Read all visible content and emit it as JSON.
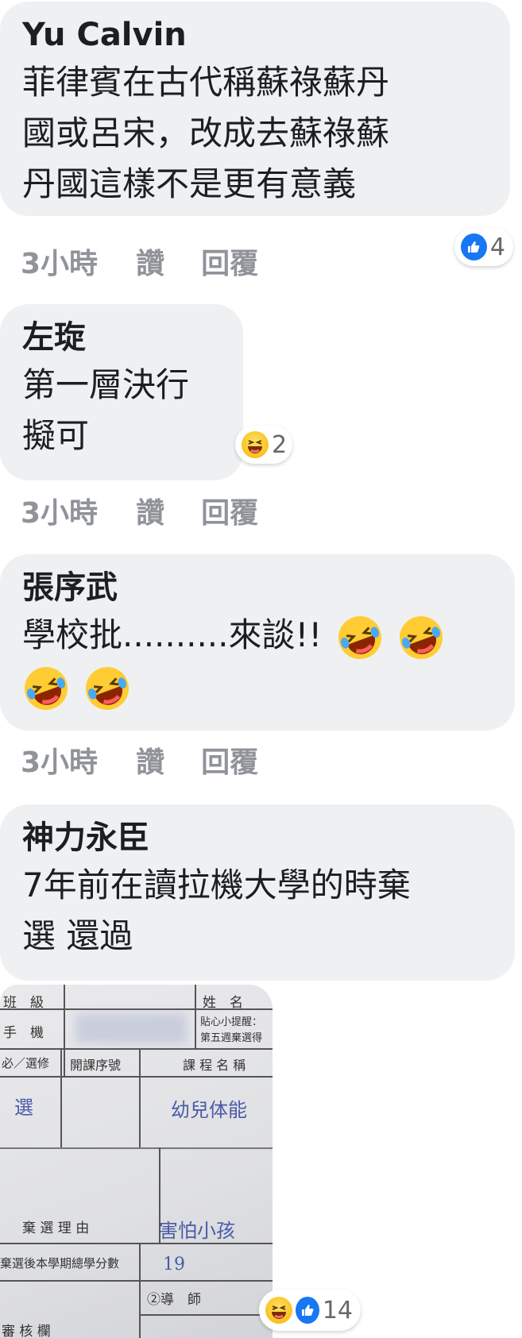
{
  "comments": [
    {
      "author": "Yu Calvin",
      "lines": [
        "菲律賓在古代稱蘇祿蘇丹",
        "國或呂宋，改成去蘇祿蘇",
        "丹國這樣不是更有意義"
      ],
      "time": "3小時",
      "like_label": "讚",
      "reply_label": "回覆",
      "reaction_count": "4",
      "reactions": [
        "like-icon"
      ]
    },
    {
      "author": "左琁",
      "lines": [
        "第一層決行",
        "擬可"
      ],
      "time": "3小時",
      "like_label": "讚",
      "reply_label": "回覆",
      "reaction_count": "2",
      "reactions": [
        "haha-icon"
      ]
    },
    {
      "author": "張序武",
      "lines": [
        "學校批..........來談!!"
      ],
      "time": "3小時",
      "like_label": "讚",
      "reply_label": "回覆",
      "emojis": [
        "rofl-emoji",
        "rofl-emoji",
        "rofl-emoji",
        "rofl-emoji"
      ]
    },
    {
      "author": "神力永臣",
      "lines": [
        "7年前在讀拉機大學的時棄",
        "選 還過"
      ],
      "reaction_count": "14",
      "reactions": [
        "haha-icon",
        "like-icon"
      ],
      "photo": {
        "cells": {
          "class": "班　級",
          "name": "姓　名",
          "phone": "手　機",
          "reminder": "貼心小提醒：",
          "week5": "第五週棄選得",
          "type": "必／選修",
          "course_no": "開課序號",
          "course_name": "課 程 名 稱",
          "reason": "棄 選 理 由",
          "credits": "棄選後本學期總學分數",
          "advisor": "②導　師",
          "review": "審 核 欄"
        },
        "handwriting": {
          "type": "選",
          "course": "幼兒体能",
          "reason": "害怕小孩",
          "credits": "19"
        }
      }
    }
  ],
  "colors": {
    "bubble": "#eff0f2",
    "meta": "#909399",
    "like_blue": "#1877f2",
    "haha_yellow": "#f7b500"
  }
}
